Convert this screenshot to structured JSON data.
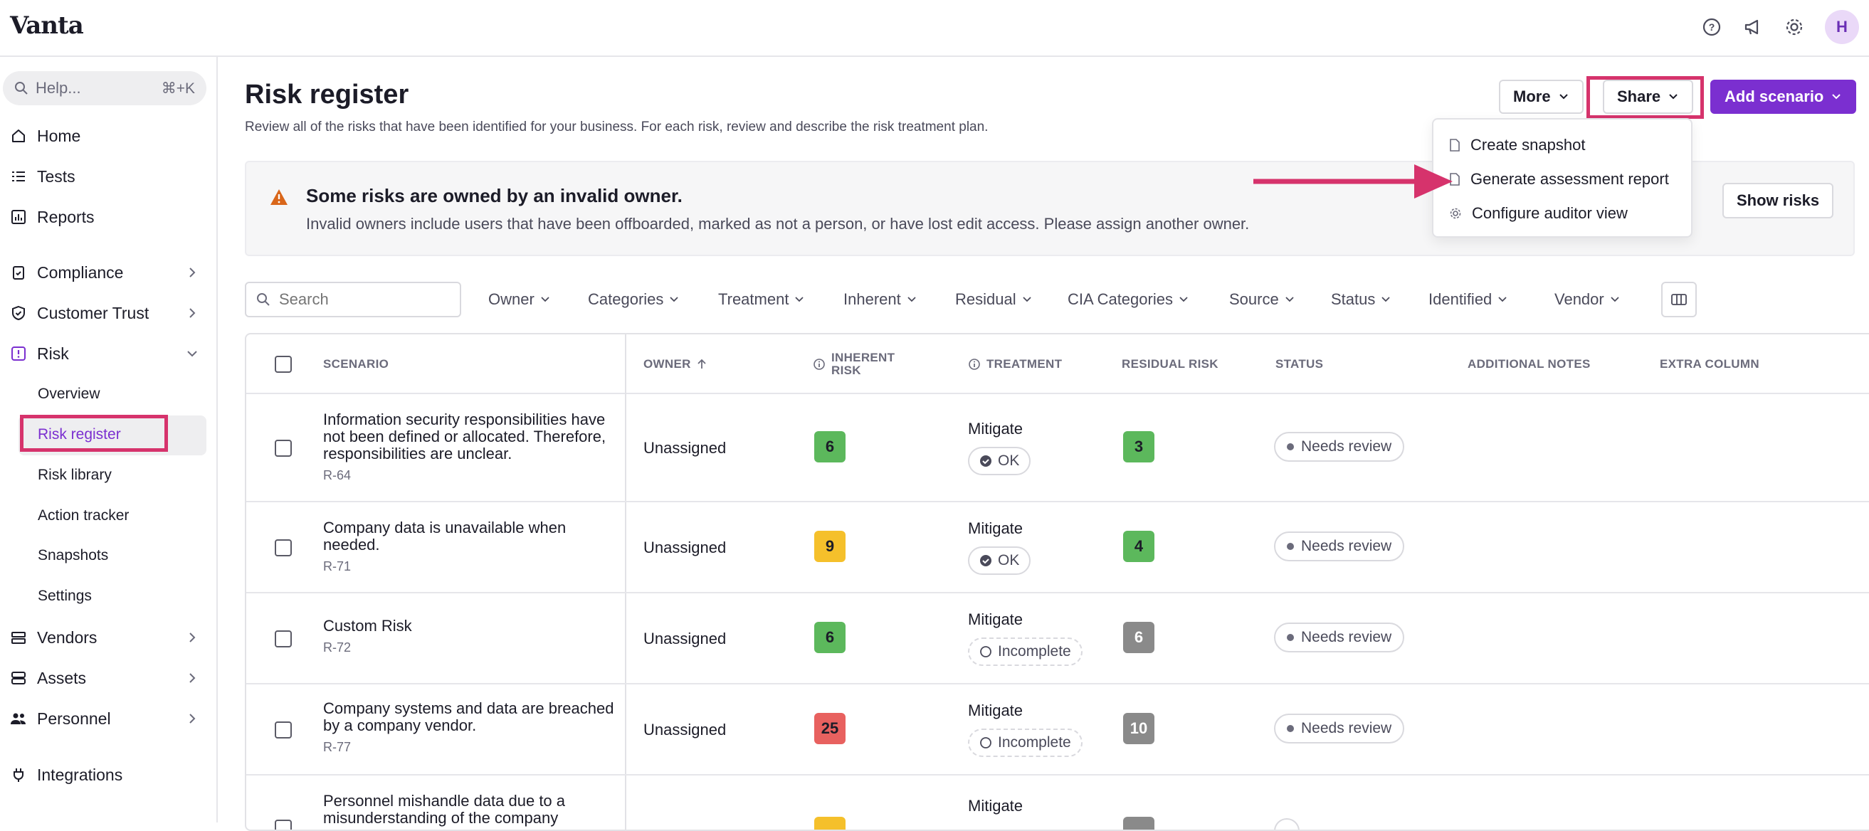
{
  "app": {
    "logo": "Vanta",
    "avatar_initial": "H"
  },
  "sidebar": {
    "help_placeholder": "Help...",
    "help_shortcut": "⌘+K",
    "items": [
      {
        "label": "Home",
        "icon": "home-icon"
      },
      {
        "label": "Tests",
        "icon": "list-icon"
      },
      {
        "label": "Reports",
        "icon": "chart-icon"
      },
      {
        "label": "Compliance",
        "icon": "clipboard-icon"
      },
      {
        "label": "Customer Trust",
        "icon": "shield-icon"
      },
      {
        "label": "Risk",
        "icon": "alert-icon"
      },
      {
        "label": "Vendors",
        "icon": "vendors-icon"
      },
      {
        "label": "Assets",
        "icon": "server-icon"
      },
      {
        "label": "Personnel",
        "icon": "people-icon"
      },
      {
        "label": "Integrations",
        "icon": "plug-icon"
      }
    ],
    "risk_sub": [
      "Overview",
      "Risk register",
      "Risk library",
      "Action tracker",
      "Snapshots",
      "Settings"
    ]
  },
  "page": {
    "title": "Risk register",
    "subtitle": "Review all of the risks that have been identified for your business. For each risk, review and describe the risk treatment plan."
  },
  "actions": {
    "more": "More",
    "share": "Share",
    "add": "Add scenario"
  },
  "share_menu": [
    "Create snapshot",
    "Generate assessment report",
    "Configure auditor view"
  ],
  "banner": {
    "title": "Some risks are owned by an invalid owner.",
    "text": "Invalid owners include users that have been offboarded, marked as not a person, or have lost edit access. Please assign another owner.",
    "button": "Show risks"
  },
  "filters": {
    "search_placeholder": "Search",
    "items": [
      "Owner",
      "Categories",
      "Treatment",
      "Inherent",
      "Residual",
      "CIA Categories",
      "Source",
      "Status",
      "Identified",
      "Vendor"
    ]
  },
  "table": {
    "headers": {
      "scenario": "SCENARIO",
      "owner": "OWNER",
      "inherent_1": "INHERENT",
      "inherent_2": "RISK",
      "treatment": "TREATMENT",
      "residual": "RESIDUAL RISK",
      "status": "STATUS",
      "notes": "ADDITIONAL NOTES",
      "extra": "EXTRA COLUMN"
    },
    "rows": [
      {
        "scenario": "Information security responsibilities have not been defined or allocated. Therefore, responsibilities are unclear.",
        "id": "R-64",
        "owner": "Unassigned",
        "inherent": "6",
        "treatment": "Mitigate",
        "treat_status": "OK",
        "residual": "3",
        "status": "Needs review"
      },
      {
        "scenario": "Company data is unavailable when needed.",
        "id": "R-71",
        "owner": "Unassigned",
        "inherent": "9",
        "treatment": "Mitigate",
        "treat_status": "OK",
        "residual": "4",
        "status": "Needs review"
      },
      {
        "scenario": "Custom Risk",
        "id": "R-72",
        "owner": "Unassigned",
        "inherent": "6",
        "treatment": "Mitigate",
        "treat_status": "Incomplete",
        "residual": "6",
        "status": "Needs review"
      },
      {
        "scenario": "Company systems and data are breached by a company vendor.",
        "id": "R-77",
        "owner": "Unassigned",
        "inherent": "25",
        "treatment": "Mitigate",
        "treat_status": "Incomplete",
        "residual": "10",
        "status": "Needs review"
      },
      {
        "scenario": "Personnel mishandle data due to a misunderstanding of the company",
        "id": "",
        "owner": "",
        "inherent": "",
        "treatment": "Mitigate",
        "treat_status": "",
        "residual": "",
        "status": ""
      }
    ]
  },
  "colors": {
    "accent": "#7b2fd0",
    "highlight": "#d6336c",
    "score_green": "#5cb85c",
    "score_yellow": "#f5c02b",
    "score_red": "#e8615f",
    "score_gray": "#8a8a8a"
  }
}
